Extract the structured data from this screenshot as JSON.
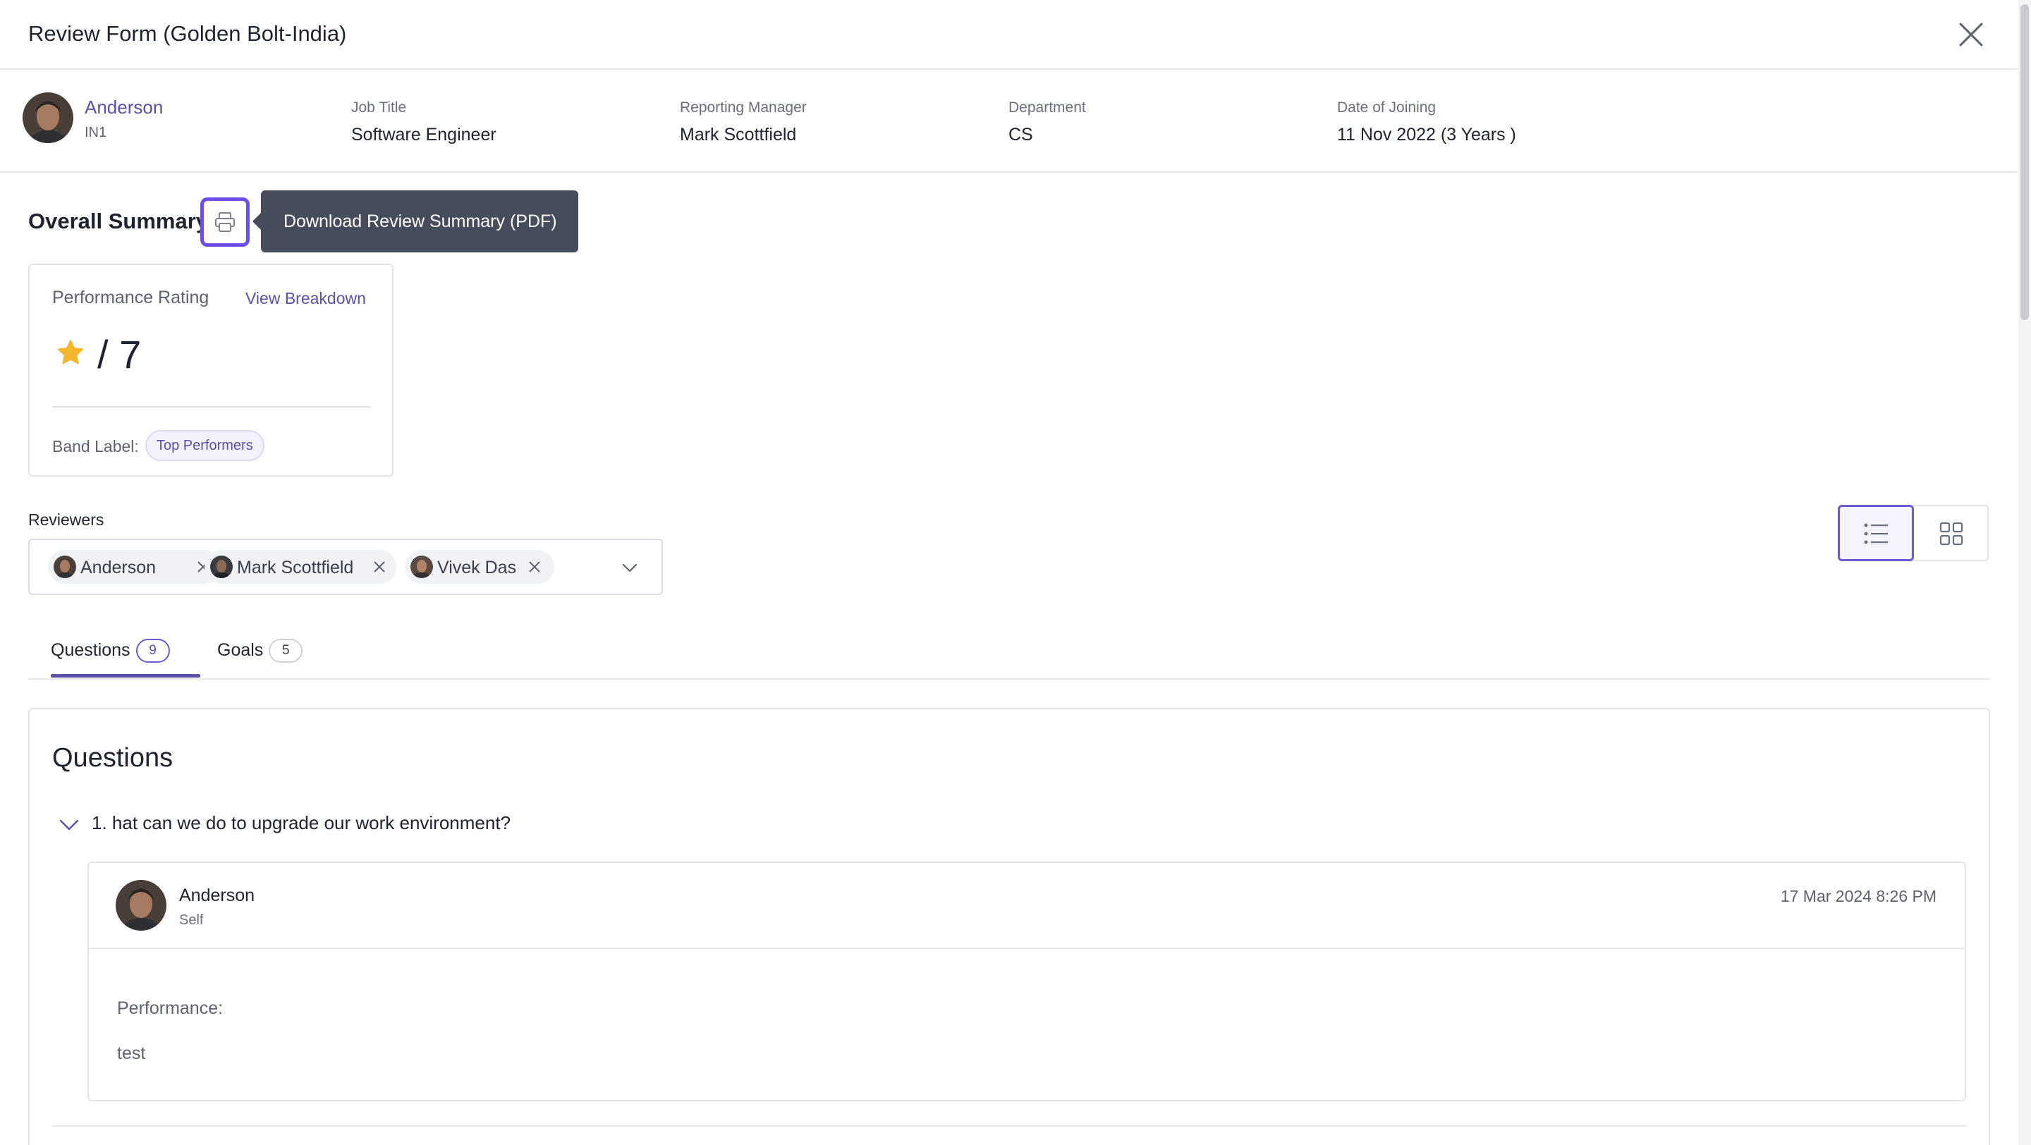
{
  "header": {
    "title": "Review Form (Golden Bolt-India)",
    "close_icon": "close-icon"
  },
  "employee": {
    "name": "Anderson",
    "code": "IN1",
    "fields": [
      {
        "label": "Job Title",
        "value": "Software Engineer"
      },
      {
        "label": "Reporting Manager",
        "value": "Mark Scottfield"
      },
      {
        "label": "Department",
        "value": "CS"
      },
      {
        "label": "Date of Joining",
        "value": "11 Nov 2022 (3 Years )"
      }
    ]
  },
  "summary": {
    "title": "Overall Summary",
    "print_icon": "printer-icon",
    "tooltip": "Download Review Summary (PDF)",
    "rating": {
      "label": "Performance Rating",
      "breakdown_link": "View Breakdown",
      "max_text": "/ 7",
      "band_label": "Band Label:",
      "band_value": "Top Performers"
    }
  },
  "reviewers": {
    "label": "Reviewers",
    "chips": [
      "Anderson",
      "Mark Scottfield",
      "Vivek Das"
    ]
  },
  "tabs": [
    {
      "label": "Questions",
      "count": "9",
      "active": true
    },
    {
      "label": "Goals",
      "count": "5",
      "active": false
    }
  ],
  "questions": {
    "title": "Questions",
    "items": [
      {
        "text": "1. hat can we do to upgrade our work environment?",
        "answer": {
          "name": "Anderson",
          "role": "Self",
          "date": "17 Mar 2024 8:26 PM",
          "label": "Performance:",
          "value": "test"
        }
      }
    ]
  },
  "colors": {
    "accent": "#5b4fa8",
    "focus_ring": "#6d4ee8",
    "tooltip_bg": "#474c5c",
    "star": "#f5b62f"
  }
}
